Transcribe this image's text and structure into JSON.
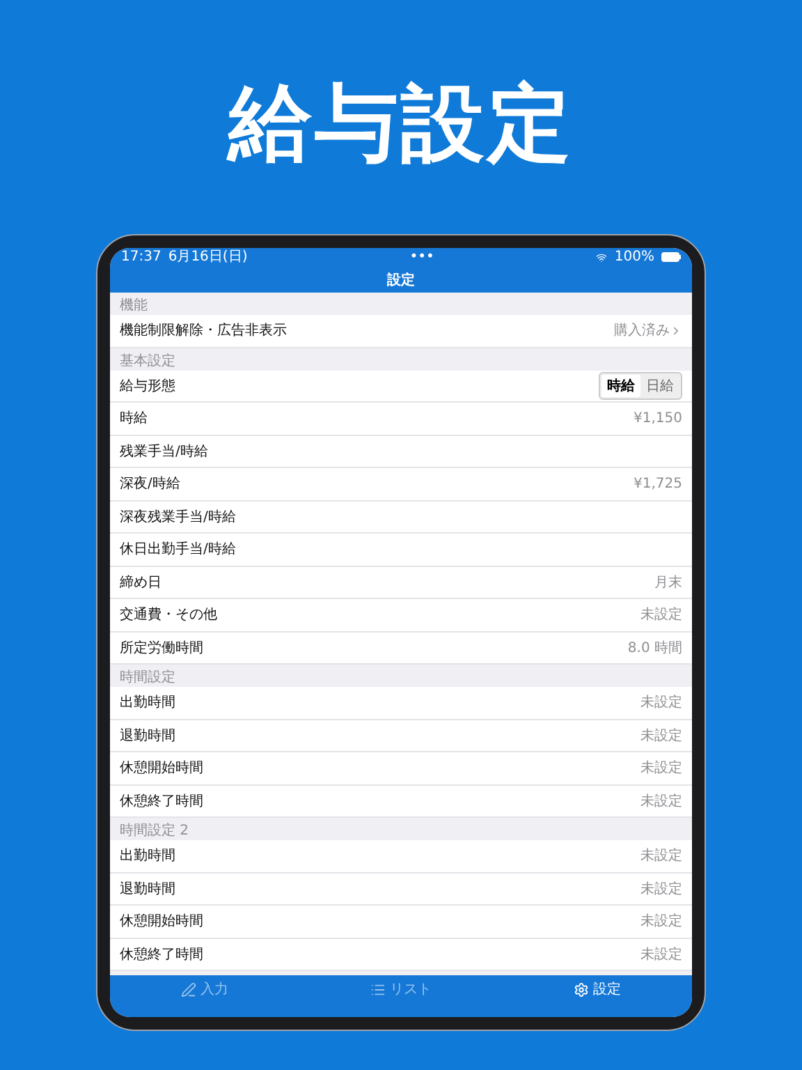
{
  "headline": "給与設定",
  "status_bar": {
    "time": "17:37",
    "date": "6月16日(日)",
    "dots": "•••",
    "battery": "100%"
  },
  "nav": {
    "title": "設定"
  },
  "sections": [
    {
      "header": "機能",
      "rows": [
        {
          "kind": "link",
          "label": "機能制限解除・広告非表示",
          "value": "購入済み"
        }
      ]
    },
    {
      "header": "基本設定",
      "rows": [
        {
          "kind": "segmented",
          "label": "給与形態",
          "options": [
            {
              "label": "時給",
              "selected": true
            },
            {
              "label": "日給",
              "selected": false
            }
          ]
        },
        {
          "kind": "value",
          "label": "時給",
          "value": "¥1,150"
        },
        {
          "kind": "value",
          "label": "残業手当/時給"
        },
        {
          "kind": "value",
          "label": "深夜/時給",
          "value": "¥1,725"
        },
        {
          "kind": "value",
          "label": "深夜残業手当/時給"
        },
        {
          "kind": "value",
          "label": "休日出勤手当/時給"
        },
        {
          "kind": "value",
          "label": "締め日",
          "value": "月末"
        },
        {
          "kind": "value",
          "label": "交通費・その他",
          "value": "未設定"
        },
        {
          "kind": "value",
          "label": "所定労働時間",
          "value": "8.0 時間"
        }
      ]
    },
    {
      "header": "時間設定",
      "rows": [
        {
          "kind": "value",
          "label": "出勤時間",
          "value": "未設定"
        },
        {
          "kind": "value",
          "label": "退勤時間",
          "value": "未設定"
        },
        {
          "kind": "value",
          "label": "休憩開始時間",
          "value": "未設定"
        },
        {
          "kind": "value",
          "label": "休憩終了時間",
          "value": "未設定"
        }
      ]
    },
    {
      "header": "時間設定 2",
      "rows": [
        {
          "kind": "value",
          "label": "出勤時間",
          "value": "未設定"
        },
        {
          "kind": "value",
          "label": "退勤時間",
          "value": "未設定"
        },
        {
          "kind": "value",
          "label": "休憩開始時間",
          "value": "未設定"
        },
        {
          "kind": "value",
          "label": "休憩終了時間",
          "value": "未設定"
        }
      ]
    }
  ],
  "tab_bar": [
    {
      "kind": "input",
      "label": "入力",
      "selected": false
    },
    {
      "kind": "list",
      "label": "リスト",
      "selected": false
    },
    {
      "kind": "gear",
      "label": "設定",
      "selected": true
    }
  ]
}
